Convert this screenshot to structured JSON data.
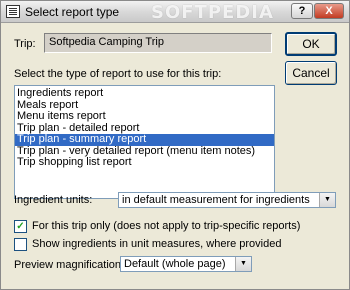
{
  "window": {
    "title": "Select report type",
    "watermark": "SOFTPEDIA",
    "help_label": "?",
    "close_label": "X"
  },
  "trip": {
    "label": "Trip:",
    "value": "Softpedia Camping Trip"
  },
  "buttons": {
    "ok": "OK",
    "cancel": "Cancel"
  },
  "report_list": {
    "instruction": "Select the type of report to use for this trip:",
    "items": [
      "Ingredients report",
      "Meals report",
      "Menu items report",
      "Trip plan - detailed report",
      "Trip plan - summary report",
      "Trip plan - very detailed report (menu item notes)",
      "Trip shopping list report"
    ],
    "selected_index": 4
  },
  "ingredient_units": {
    "label": "Ingredient units:",
    "value": "in default measurement for ingredients"
  },
  "options": {
    "this_trip_only": {
      "label": "For this trip only (does not apply to trip-specific reports)",
      "checked": true
    },
    "show_in_unit_measures": {
      "label": "Show ingredients in unit measures, where provided",
      "checked": false
    }
  },
  "preview": {
    "label": "Preview magnification:",
    "value": "Default (whole page)"
  },
  "icons": {
    "app": "report-icon",
    "dropdown": "chevron-down-icon",
    "check": "checkmark-icon"
  },
  "colors": {
    "selection": "#316ac5",
    "dialog_bg": "#ece9d8",
    "close_red": "#c23b22"
  }
}
